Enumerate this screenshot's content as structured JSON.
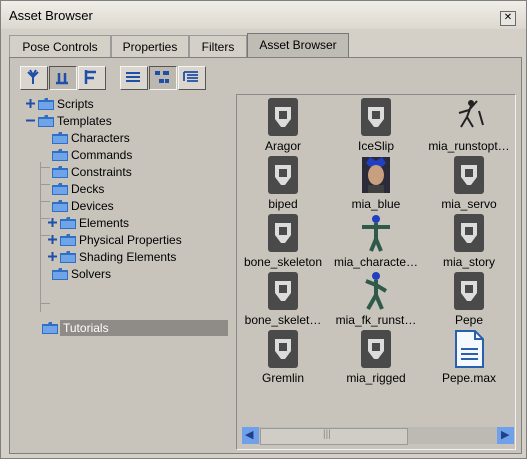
{
  "window": {
    "title": "Asset Browser",
    "close_glyph": "✕"
  },
  "tabs": [
    {
      "label": "Pose Controls"
    },
    {
      "label": "Properties"
    },
    {
      "label": "Filters"
    },
    {
      "label": "Asset Browser",
      "active": true
    }
  ],
  "toolbar": {
    "buttons": [
      {
        "icon": "tree-view-icon",
        "pressed": false
      },
      {
        "icon": "pedestal-view-icon",
        "pressed": true
      },
      {
        "icon": "side-view-icon",
        "pressed": false
      },
      {
        "icon": "list-view-icon",
        "pressed": false
      },
      {
        "icon": "thumbnail-view-icon",
        "pressed": true
      },
      {
        "icon": "detail-view-icon",
        "pressed": false
      }
    ]
  },
  "tree": {
    "items": [
      {
        "label": "Scripts",
        "expander": "+"
      },
      {
        "label": "Templates",
        "expander": "-"
      },
      {
        "label": "Characters"
      },
      {
        "label": "Commands"
      },
      {
        "label": "Constraints"
      },
      {
        "label": "Decks"
      },
      {
        "label": "Devices"
      },
      {
        "label": "Elements",
        "expander": "+"
      },
      {
        "label": "Physical Properties",
        "expander": "+"
      },
      {
        "label": "Shading Elements",
        "expander": "+"
      },
      {
        "label": "Solvers"
      },
      {
        "label": "Tutorials",
        "selected": true
      }
    ]
  },
  "assets": [
    {
      "name": "Aragor",
      "icon": "model-icon"
    },
    {
      "name": "IceSlip",
      "icon": "model-icon"
    },
    {
      "name": "mia_runstopt…",
      "icon": "skeleton-figure-icon"
    },
    {
      "name": "biped",
      "icon": "model-icon"
    },
    {
      "name": "mia_blue",
      "icon": "character-portrait-icon"
    },
    {
      "name": "mia_servo",
      "icon": "model-icon"
    },
    {
      "name": "bone_skeleton",
      "icon": "model-icon"
    },
    {
      "name": "mia_characte…",
      "icon": "character-tpose-icon"
    },
    {
      "name": "mia_story",
      "icon": "model-icon"
    },
    {
      "name": "bone_skelet…",
      "icon": "model-icon"
    },
    {
      "name": "mia_fk_runst…",
      "icon": "character-run-icon"
    },
    {
      "name": "Pepe",
      "icon": "model-icon"
    },
    {
      "name": "Gremlin",
      "icon": "model-icon"
    },
    {
      "name": "mia_rigged",
      "icon": "model-icon"
    },
    {
      "name": "Pepe.max",
      "icon": "max-file-icon"
    }
  ],
  "scrollbar": {
    "left_glyph": "◀",
    "right_glyph": "▶",
    "grip": "|||",
    "position": 0.0
  }
}
